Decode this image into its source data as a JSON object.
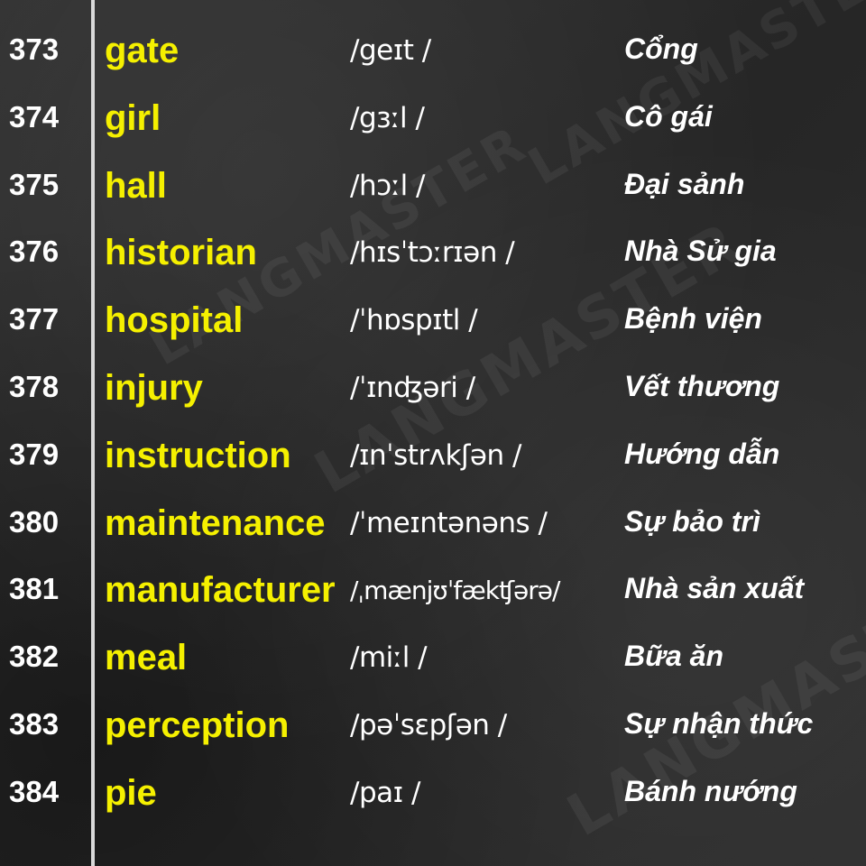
{
  "entries": [
    {
      "num": "373",
      "word": "gate",
      "ipa": "/geɪt /",
      "meaning": "Cổng"
    },
    {
      "num": "374",
      "word": "girl",
      "ipa": "/gɜːl /",
      "meaning": "Cô gái"
    },
    {
      "num": "375",
      "word": "hall",
      "ipa": "/hɔːl /",
      "meaning": "Đại sảnh"
    },
    {
      "num": "376",
      "word": "historian",
      "ipa": "/hɪsˈtɔːrɪən /",
      "meaning": "Nhà Sử gia"
    },
    {
      "num": "377",
      "word": "hospital",
      "ipa": "/ˈhɒspɪtl /",
      "meaning": "Bệnh viện"
    },
    {
      "num": "378",
      "word": "injury",
      "ipa": "/ˈɪnʤəri /",
      "meaning": "Vết thương"
    },
    {
      "num": "379",
      "word": "instruction",
      "ipa": "/ɪnˈstrʌkʃən /",
      "meaning": "Hướng dẫn"
    },
    {
      "num": "380",
      "word": "maintenance",
      "ipa": "/ˈmeɪntənəns /",
      "meaning": "Sự bảo trì"
    },
    {
      "num": "381",
      "word": "manufacturer",
      "ipa": "/ˌmænjʊˈfækʧərə/",
      "meaning": "Nhà sản xuất"
    },
    {
      "num": "382",
      "word": "meal",
      "ipa": "/miːl /",
      "meaning": "Bữa ăn"
    },
    {
      "num": "383",
      "word": "perception",
      "ipa": "/pəˈsɛpʃən /",
      "meaning": "Sự nhận thức"
    },
    {
      "num": "384",
      "word": "pie",
      "ipa": "/paɪ /",
      "meaning": "Bánh nướng"
    }
  ],
  "watermark": "LANGMASTER",
  "colors": {
    "word": "#f5f000",
    "text": "#ffffff",
    "background": "#2b2b2b"
  }
}
